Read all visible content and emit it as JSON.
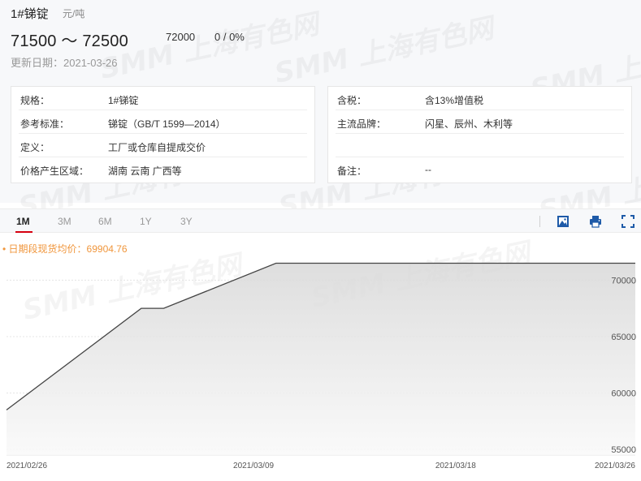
{
  "product": {
    "name": "1#锑锭",
    "unit": "元/吨",
    "price_range": "71500 ～ 72500",
    "average": "72000",
    "change": "0 / 0%",
    "update_label": "更新日期：",
    "update_date": "2021-03-26"
  },
  "specs_left": [
    {
      "label": "规格：",
      "value": "1#锑锭"
    },
    {
      "label": "参考标准：",
      "value": "锑锭（GB/T 1599—2014）"
    },
    {
      "label": "定义：",
      "value": "工厂或仓库自提成交价"
    },
    {
      "label": "价格产生区域：",
      "value": "湖南 云南 广西等"
    }
  ],
  "specs_right": [
    {
      "label": "含税：",
      "value": "含13%增值税"
    },
    {
      "label": "主流品牌：",
      "value": "闪星、辰州、木利等"
    },
    {
      "label": "",
      "value": ""
    },
    {
      "label": "备注：",
      "value": "--"
    }
  ],
  "tabs": [
    {
      "label": "1M",
      "active": true
    },
    {
      "label": "3M",
      "active": false
    },
    {
      "label": "6M",
      "active": false
    },
    {
      "label": "1Y",
      "active": false
    },
    {
      "label": "3Y",
      "active": false
    }
  ],
  "toolbar": {
    "image_icon": "image-icon",
    "print_icon": "print-icon",
    "fullscreen_icon": "fullscreen-icon"
  },
  "watermark_text": "SMM 上海有色网",
  "colors": {
    "accent": "#d6000f",
    "icon_blue": "#1e5aa8",
    "legend": "#f0963c",
    "line": "#444444"
  },
  "chart_data": {
    "type": "area",
    "legend": "日期段现货均价：69904.76",
    "x": [
      "2021/02/26",
      "2021/03/04",
      "2021/03/05",
      "2021/03/10",
      "2021/03/26"
    ],
    "y": [
      58500,
      67500,
      67500,
      71500,
      71500
    ],
    "xticks": [
      "2021/02/26",
      "2021/03/09",
      "2021/03/18",
      "2021/03/26"
    ],
    "yticks": [
      55000,
      60000,
      65000,
      70000
    ],
    "ylim": [
      54500,
      72400
    ],
    "grid": true,
    "y_axis_position": "right"
  }
}
